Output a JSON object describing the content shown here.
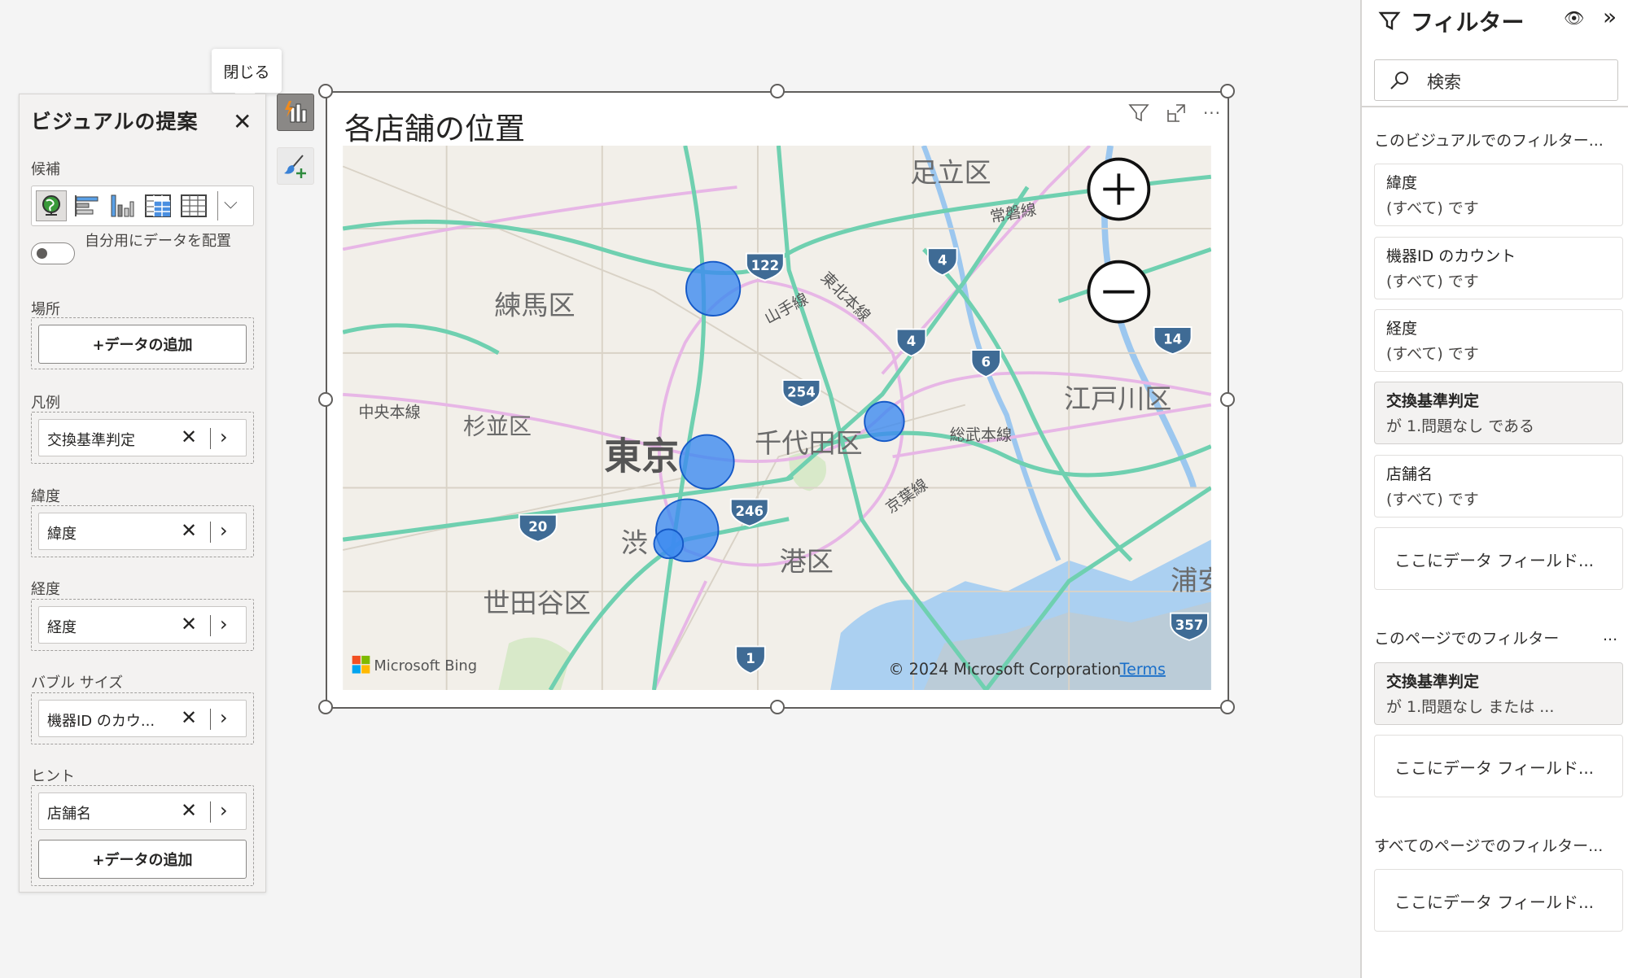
{
  "tooltip": "閉じる",
  "suggest_panel": {
    "title": "ビジュアルの提案",
    "candidates_label": "候補",
    "visual_icons": [
      "globe-map-icon",
      "clustered-bar-icon",
      "column-chart-icon",
      "matrix-icon",
      "table-icon"
    ],
    "toggle_label": "自分用にデータを配置",
    "toggle_on": false,
    "wells": [
      {
        "label": "場所",
        "fields": [],
        "add_label": "+データの追加"
      },
      {
        "label": "凡例",
        "fields": [
          "交換基準判定"
        ]
      },
      {
        "label": "緯度",
        "fields": [
          "緯度"
        ]
      },
      {
        "label": "経度",
        "fields": [
          "経度"
        ]
      },
      {
        "label": "バブル サイズ",
        "fields": [
          "機器ID のカウ..."
        ]
      },
      {
        "label": "ヒント",
        "fields": [
          "店舗名"
        ],
        "add_label": "+データの追加"
      }
    ]
  },
  "visual": {
    "title": "各店舗の位置",
    "map": {
      "labels": [
        "足立区",
        "練馬区",
        "杉並区",
        "東京",
        "千代田区",
        "江戸川区",
        "港区",
        "世田谷区",
        "渋",
        "浦安",
        "中央本線",
        "総武本線",
        "常磐線",
        "山手線",
        "東北本線",
        "京葉線"
      ],
      "routes": [
        "122",
        "4",
        "4",
        "6",
        "14",
        "254",
        "246",
        "20",
        "1",
        "357"
      ],
      "provider": "Microsoft Bing",
      "copyright": "© 2024 Microsoft Corporation",
      "terms": "Terms",
      "bubble_color": "#3d8bf0"
    }
  },
  "filters": {
    "title": "フィルター",
    "search_placeholder": "検索",
    "visual_section": "このビジュアルでのフィルター...",
    "visual_filters": [
      {
        "name": "緯度",
        "state": "(すべて) です",
        "active": false
      },
      {
        "name": "機器ID のカウント",
        "state": "(すべて) です",
        "active": false
      },
      {
        "name": "経度",
        "state": "(すべて) です",
        "active": false
      },
      {
        "name": "交換基準判定",
        "state": "が 1.問題なし である",
        "active": true
      },
      {
        "name": "店舗名",
        "state": "(すべて) です",
        "active": false
      }
    ],
    "drop_placeholder": "ここにデータ フィールド...",
    "page_section": "このページでのフィルター",
    "page_more": "...",
    "page_filters": [
      {
        "name": "交換基準判定",
        "state": "が 1.問題なし または ...",
        "active": true
      }
    ],
    "all_section": "すべてのページでのフィルター..."
  }
}
